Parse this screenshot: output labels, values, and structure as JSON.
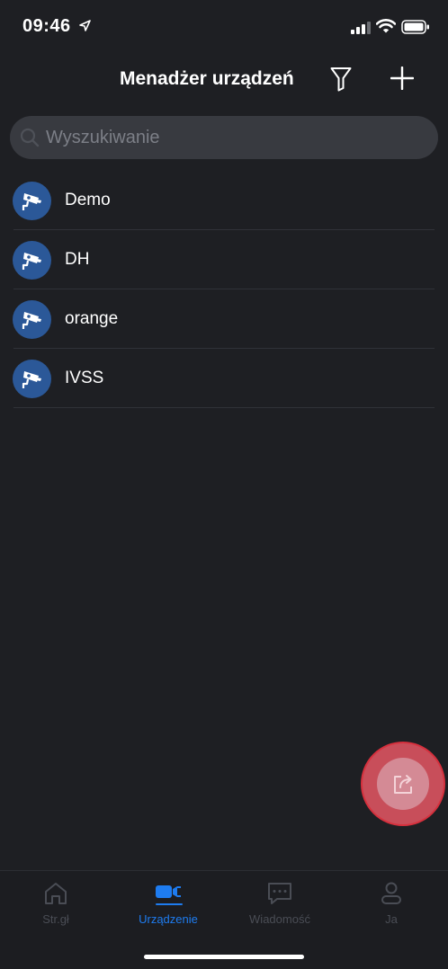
{
  "status_bar": {
    "time": "09:46"
  },
  "header": {
    "title": "Menadżer urządzeń"
  },
  "search": {
    "placeholder": "Wyszukiwanie",
    "value": ""
  },
  "devices": [
    {
      "name": "Demo"
    },
    {
      "name": "DH"
    },
    {
      "name": "orange"
    },
    {
      "name": "IVSS"
    }
  ],
  "tabs": [
    {
      "label": "Str.gł",
      "icon": "home-icon",
      "active": false
    },
    {
      "label": "Urządzenie",
      "icon": "camera-icon",
      "active": true
    },
    {
      "label": "Wiadomość",
      "icon": "message-icon",
      "active": false
    },
    {
      "label": "Ja",
      "icon": "user-icon",
      "active": false
    }
  ],
  "colors": {
    "background": "#1e1f23",
    "accent": "#1e7cf0",
    "avatar": "#2b5898",
    "fab": "#d48a95"
  }
}
